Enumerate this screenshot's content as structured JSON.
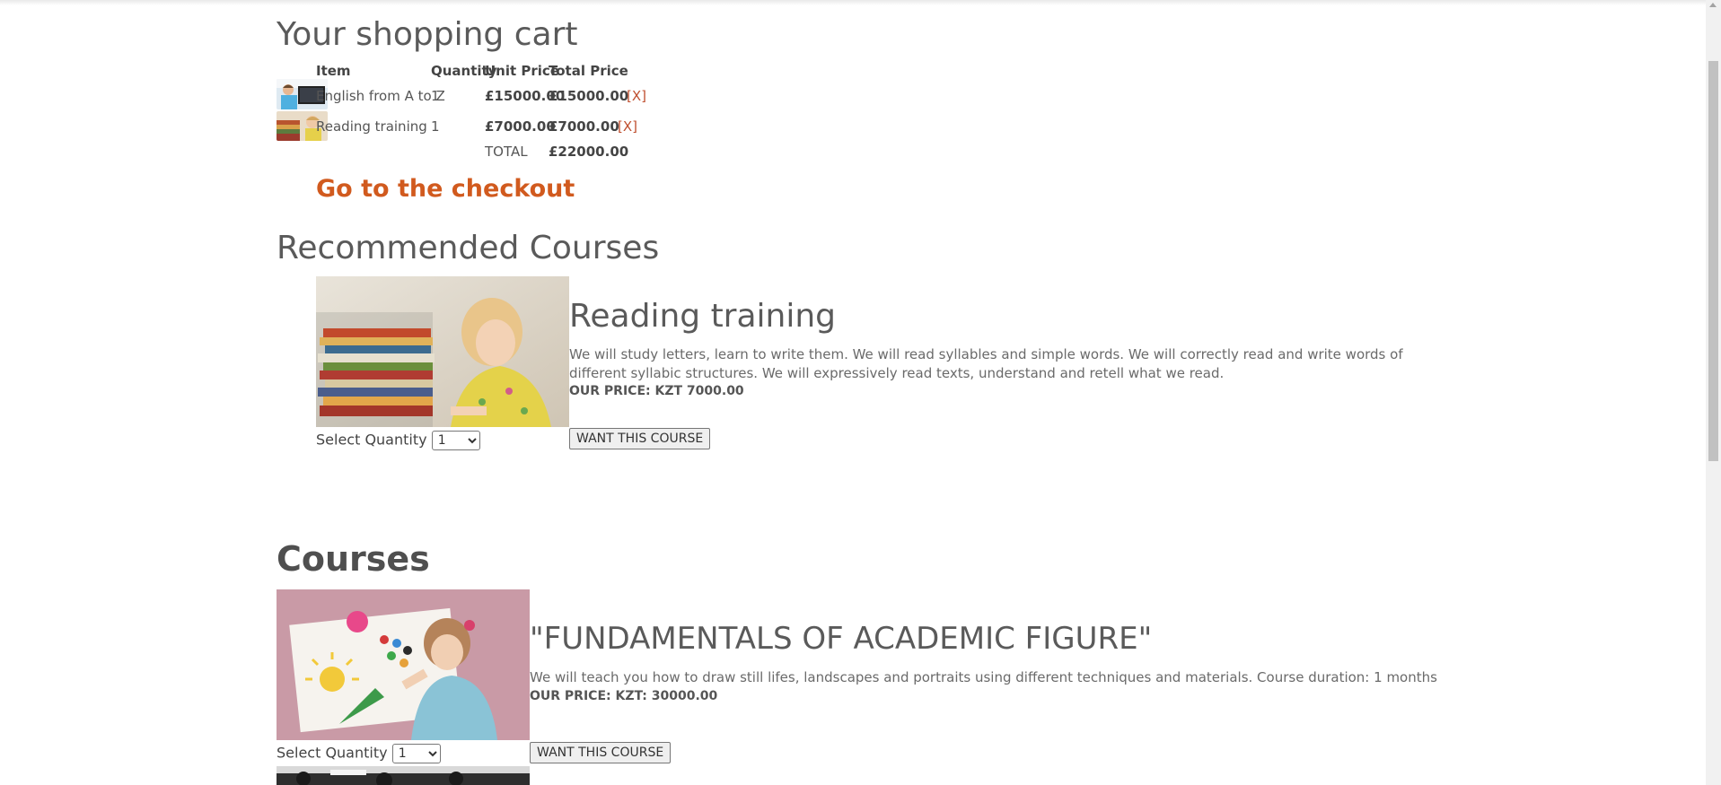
{
  "cart": {
    "title": "Your shopping cart",
    "headers": {
      "item": "Item",
      "quantity": "Quantity",
      "unit_price": "Unit Price",
      "total_price": "Total Price"
    },
    "rows": [
      {
        "item": "English from A to Z",
        "quantity": "1",
        "unit_price": "£15000.00",
        "total_price": "£15000.00",
        "remove": "[X]",
        "thumb_icon": "boy-laptop-image"
      },
      {
        "item": "Reading training",
        "quantity": "1",
        "unit_price": "£7000.00",
        "total_price": "£7000.00",
        "remove": "[X]",
        "thumb_icon": "girl-books-image"
      }
    ],
    "total_label": "TOTAL",
    "total_value": "£22000.00",
    "checkout_link": "Go to the checkout"
  },
  "recommended": {
    "title": "Recommended Courses",
    "course": {
      "name": "Reading training",
      "description": "We will study letters, learn to write them. We will read syllables and simple words. We will correctly read and write words of different syllabic structures. We will expressively read texts, understand and retell what we read.",
      "price": "OUR PRICE: KZT 7000.00",
      "qty_label": "Select Quantity",
      "qty_value": "1",
      "button": "WANT THIS COURSE"
    }
  },
  "courses": {
    "title": "Courses",
    "items": [
      {
        "name": "\"FUNDAMENTALS OF ACADEMIC FIGURE\"",
        "description": "We will teach you how to draw still lifes, landscapes and portraits using different techniques and materials. Course duration: 1 months",
        "price": "OUR PRICE: KZT: 30000.00",
        "qty_label": "Select Quantity",
        "qty_value": "1",
        "button": "WANT THIS COURSE"
      }
    ]
  },
  "colors": {
    "link": "#d15a1e",
    "remove": "#c05030",
    "text": "#555555"
  }
}
